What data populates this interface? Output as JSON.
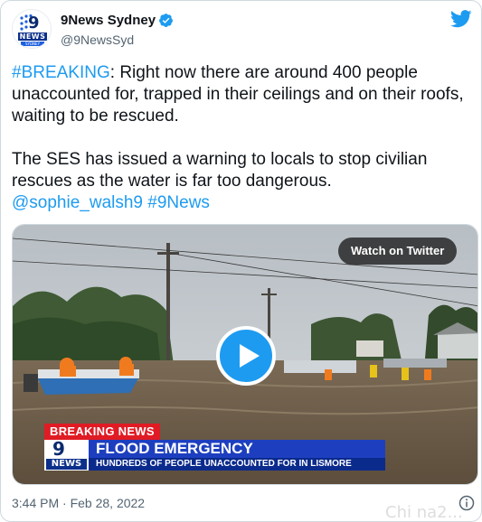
{
  "account": {
    "display_name": "9News Sydney",
    "handle": "@9NewsSyd",
    "verified": true,
    "avatar_text_nine": "9",
    "avatar_text_news": "NEWS",
    "avatar_text_sydney": "SYDNEY"
  },
  "tweet": {
    "hashtag_breaking": "#BREAKING",
    "line1_rest": ": Right now there are around 400 people unaccounted for, trapped in their ceilings and on their roofs, waiting to be rescued.",
    "paragraph2": "The SES has issued a warning to locals to stop civilian rescues as the water is far too dangerous.",
    "mention": "@sophie_walsh9",
    "hashtag_9news": "#9News",
    "timestamp": "3:44 PM · Feb 28, 2022"
  },
  "media": {
    "watch_label": "Watch on Twitter",
    "banner_breaking": "BREAKING NEWS",
    "banner_logo_nine": "9",
    "banner_logo_news": "NEWS",
    "banner_headline": "FLOOD EMERGENCY",
    "banner_sub": "HUNDREDS OF PEOPLE UNACCOUNTED FOR IN LISMORE"
  },
  "icons": {
    "bird": "twitter-bird-icon",
    "verified": "verified-badge-icon",
    "play": "play-icon",
    "info": "info-icon"
  },
  "colors": {
    "accent": "#1d9bf0",
    "text": "#0f1419",
    "muted": "#536471",
    "breaking_red": "#e01b24",
    "news_blue": "#1d3fbf"
  },
  "watermark": "Chi na2..."
}
